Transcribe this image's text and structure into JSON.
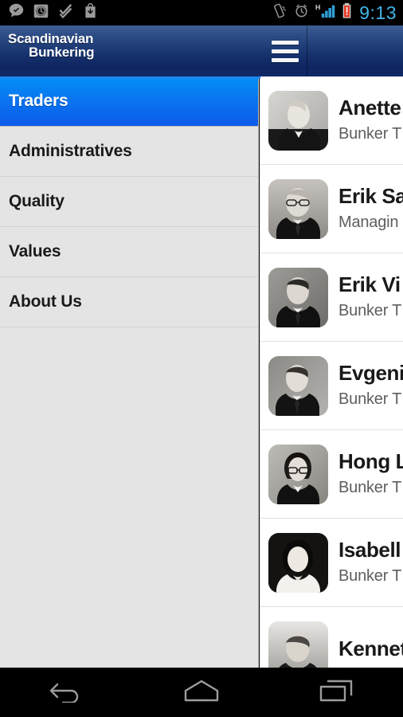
{
  "status_bar": {
    "time": "9:13",
    "left_icons": [
      {
        "name": "message-check-icon",
        "label": "message"
      },
      {
        "name": "alarm-clock-icon",
        "label": "alarm"
      },
      {
        "name": "double-check-icon",
        "label": "tasks"
      },
      {
        "name": "download-bag-icon",
        "label": "download"
      }
    ],
    "right_icons": [
      {
        "name": "vibrate-icon",
        "label": "vibrate"
      },
      {
        "name": "alarm-clock-icon",
        "label": "alarm"
      },
      {
        "name": "signal-h-icon",
        "label": "H"
      },
      {
        "name": "battery-low-icon",
        "label": "battery"
      }
    ],
    "signal_label": "H",
    "clock_color": "#41B6E6",
    "battery_color": "#E23B28"
  },
  "app_bar": {
    "logo_line1": "Scandinavian",
    "logo_line2": "Bunkering",
    "menu_label": "Menu",
    "gradient_top": "#3E5E96",
    "gradient_bottom": "#102A66",
    "accent_underline": "#1E86F0"
  },
  "sidebar": {
    "background": "#E4E4E4",
    "active_color": "#0B74F0",
    "items": [
      {
        "label": "Traders",
        "active": true
      },
      {
        "label": "Administratives",
        "active": false
      },
      {
        "label": "Quality",
        "active": false
      },
      {
        "label": "Values",
        "active": false
      },
      {
        "label": "About Us",
        "active": false
      }
    ]
  },
  "contact_list": {
    "contacts": [
      {
        "name": "Anette",
        "role": "Bunker T"
      },
      {
        "name": "Erik Sa",
        "role": "Managin"
      },
      {
        "name": "Erik Vi",
        "role": "Bunker T"
      },
      {
        "name": "Evgeni",
        "role": "Bunker T"
      },
      {
        "name": "Hong L",
        "role": "Bunker T"
      },
      {
        "name": "Isabell",
        "role": "Bunker T"
      },
      {
        "name": "Kennet",
        "role": ""
      }
    ]
  },
  "nav_bar": {
    "buttons": [
      {
        "name": "back-button",
        "label": "Back"
      },
      {
        "name": "home-button",
        "label": "Home"
      },
      {
        "name": "recents-button",
        "label": "Recents"
      }
    ]
  }
}
